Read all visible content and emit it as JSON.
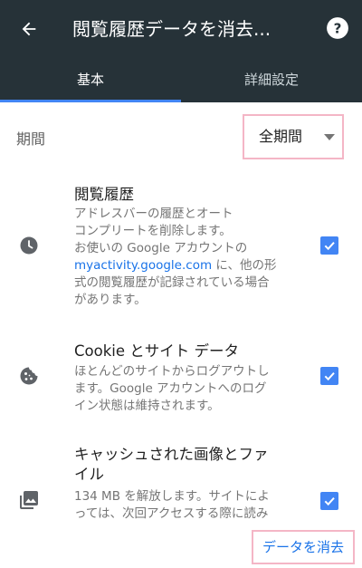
{
  "header": {
    "title": "閲覧履歴データを消去...",
    "colors": {
      "background": "#263238",
      "accent": "#4285f4"
    }
  },
  "tabs": [
    {
      "label": "基本",
      "selected": true
    },
    {
      "label": "詳細設定",
      "selected": false
    }
  ],
  "period": {
    "label": "期間",
    "selected": "全期間"
  },
  "items": [
    {
      "icon": "clock-icon",
      "title": "閲覧履歴",
      "desc_lines": [
        "アドレスバーの履歴とオート",
        "コンプリートを削除します。",
        "お使いの Google アカウントの"
      ],
      "desc_link": "myactivity.google.com",
      "desc_after_link": " に、他の形",
      "desc_tail_lines": [
        "式の閲覧履歴が記録されている場合",
        "があります。"
      ],
      "checked": true
    },
    {
      "icon": "cookie-icon",
      "title": "Cookie とサイト データ",
      "desc_lines": [
        "ほとんどのサイトからログアウトし",
        "ます。Google アカウントへのログ",
        "イン状態は維持されます。"
      ],
      "checked": true
    },
    {
      "icon": "image-icon",
      "title_lines": [
        "キャッシュされた画像とファ",
        "イル"
      ],
      "desc_lines": [
        "134 MB を解放します。サイトによ",
        "っては、次回アクセスする際に読み"
      ],
      "checked": true
    }
  ],
  "footer": {
    "clear_label": "データを消去"
  }
}
